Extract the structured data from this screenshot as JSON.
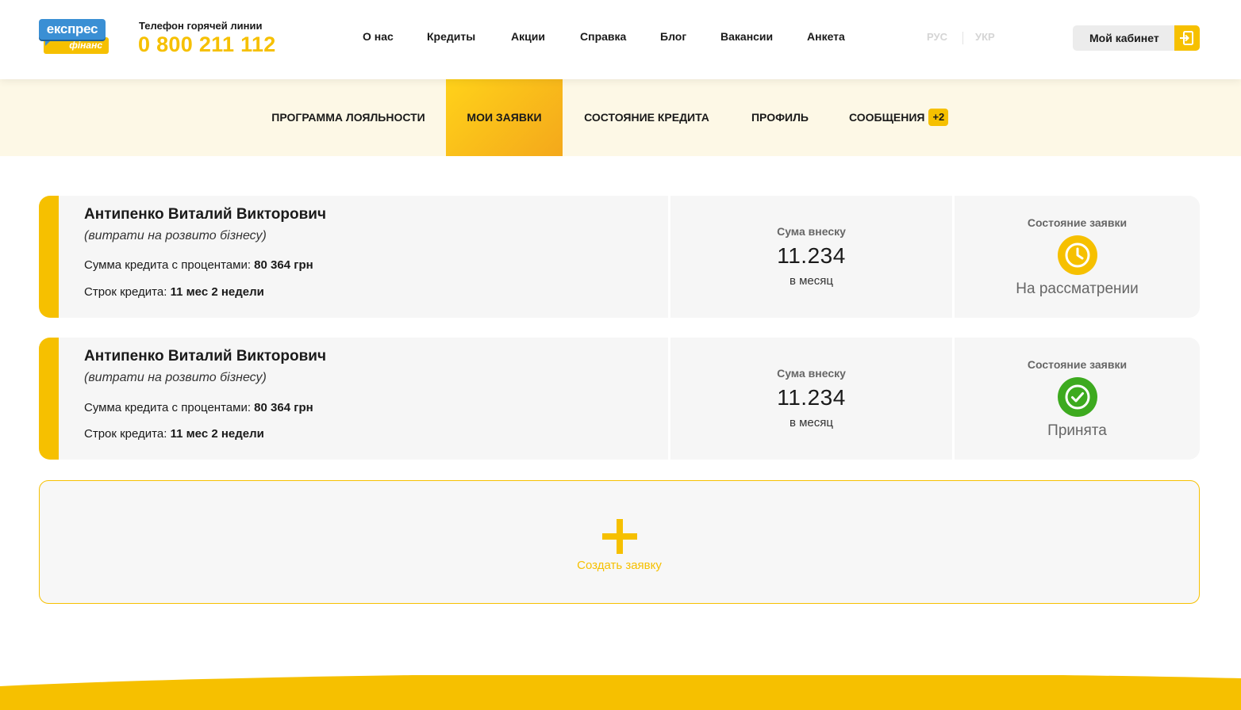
{
  "brand": {
    "logo_top": "експрес",
    "logo_bottom": "фінанс",
    "accent": "#f6c000"
  },
  "hotline": {
    "label": "Телефон горячей линии",
    "number": "0 800 211 112"
  },
  "topnav": [
    "О нас",
    "Кредиты",
    "Акции",
    "Справка",
    "Блог",
    "Вакансии",
    "Анкета"
  ],
  "languages": [
    "РУС",
    "УКР"
  ],
  "cabinet": {
    "label": "Мой кабинет",
    "icon": "login-icon"
  },
  "subnav": {
    "loyalty": "ПРОГРАММА ЛОЯЛЬНОСТИ",
    "my_requests": "МОИ ЗАЯВКИ",
    "credit_state": "СОСТОЯНИЕ КРЕДИТА",
    "profile": "ПРОФИЛЬ",
    "messages": "СООБЩЕНИЯ",
    "messages_badge": "+2",
    "active": "МОИ ЗАЯВКИ"
  },
  "applications": [
    {
      "name": "Антипенко Виталий Викторович",
      "purpose": "(витрати на розвито бізнесу)",
      "sum_label": "Сумма кредита с процентами:",
      "sum_value": "80 364 грн",
      "term_label": "Строк кредита:",
      "term_value": "11 мес 2 недели",
      "payment_label": "Сума внеску",
      "payment_value": "11.234",
      "payment_unit": "в месяц",
      "status_label": "Состояние заявки",
      "status_text": "На рассматрении",
      "status_icon": "clock-icon",
      "status_color": "#f6c000"
    },
    {
      "name": "Антипенко Виталий Викторович",
      "purpose": "(витрати на розвито бізнесу)",
      "sum_label": "Сумма кредита с процентами:",
      "sum_value": "80 364 грн",
      "term_label": "Строк кредита:",
      "term_value": "11 мес 2 недели",
      "payment_label": "Сума внеску",
      "payment_value": "11.234",
      "payment_unit": "в месяц",
      "status_label": "Состояние заявки",
      "status_text": "Принята",
      "status_icon": "check-circle-icon",
      "status_color": "#3daa1f"
    }
  ],
  "create": {
    "label": "Создать заявку",
    "icon": "plus-icon"
  }
}
